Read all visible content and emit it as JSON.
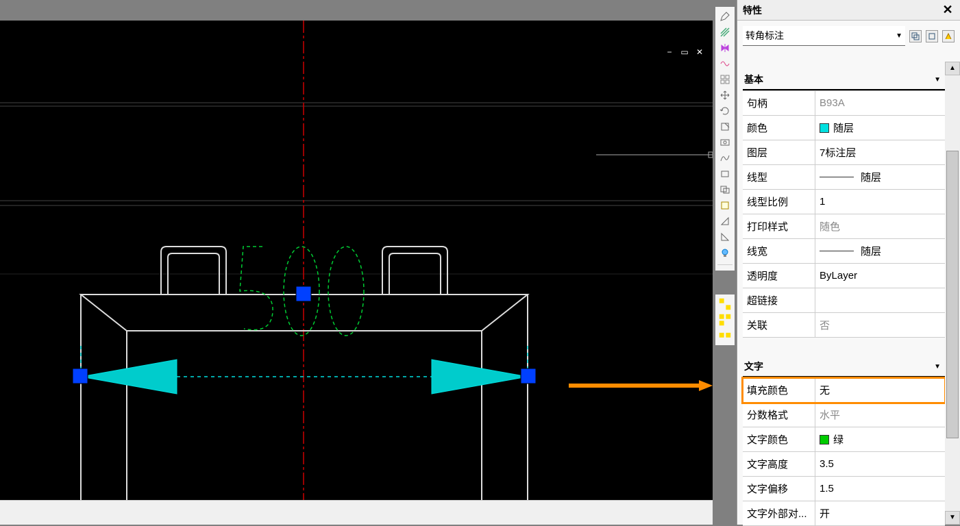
{
  "panel": {
    "title": "特性",
    "selector": "转角标注"
  },
  "sections": {
    "basic": {
      "header": "基本",
      "rows": {
        "handle": {
          "label": "句柄",
          "value": "B93A"
        },
        "color": {
          "label": "颜色",
          "value": "随层"
        },
        "layer": {
          "label": "图层",
          "value": "7标注层"
        },
        "linetype": {
          "label": "线型",
          "value": "随层"
        },
        "ltscale": {
          "label": "线型比例",
          "value": "1"
        },
        "plotstyle": {
          "label": "打印样式",
          "value": "随色"
        },
        "lineweight": {
          "label": "线宽",
          "value": "随层"
        },
        "transparency": {
          "label": "透明度",
          "value": "ByLayer"
        },
        "hyperlink": {
          "label": "超链接",
          "value": ""
        },
        "assoc": {
          "label": "关联",
          "value": "否"
        }
      }
    },
    "text": {
      "header": "文字",
      "rows": {
        "fillcolor": {
          "label": "填充颜色",
          "value": "无"
        },
        "fraction": {
          "label": "分数格式",
          "value": "水平"
        },
        "textcolor": {
          "label": "文字颜色",
          "value": "绿"
        },
        "textheight": {
          "label": "文字高度",
          "value": "3.5"
        },
        "textoffset": {
          "label": "文字偏移",
          "value": "1.5"
        },
        "textoutside": {
          "label": "文字外部对...",
          "value": "开"
        }
      }
    }
  },
  "drawing": {
    "dim_value": "500"
  },
  "toolbar_icons": [
    "pencil",
    "hatch",
    "mirror",
    "pattern",
    "grid",
    "move",
    "rotate",
    "extract",
    "zoom",
    "spline",
    "rect",
    "rect2",
    "snap",
    "tri1",
    "tri2",
    "bulb"
  ],
  "toolbar_icons_2": [
    "grp1",
    "grp2",
    "grp3"
  ]
}
